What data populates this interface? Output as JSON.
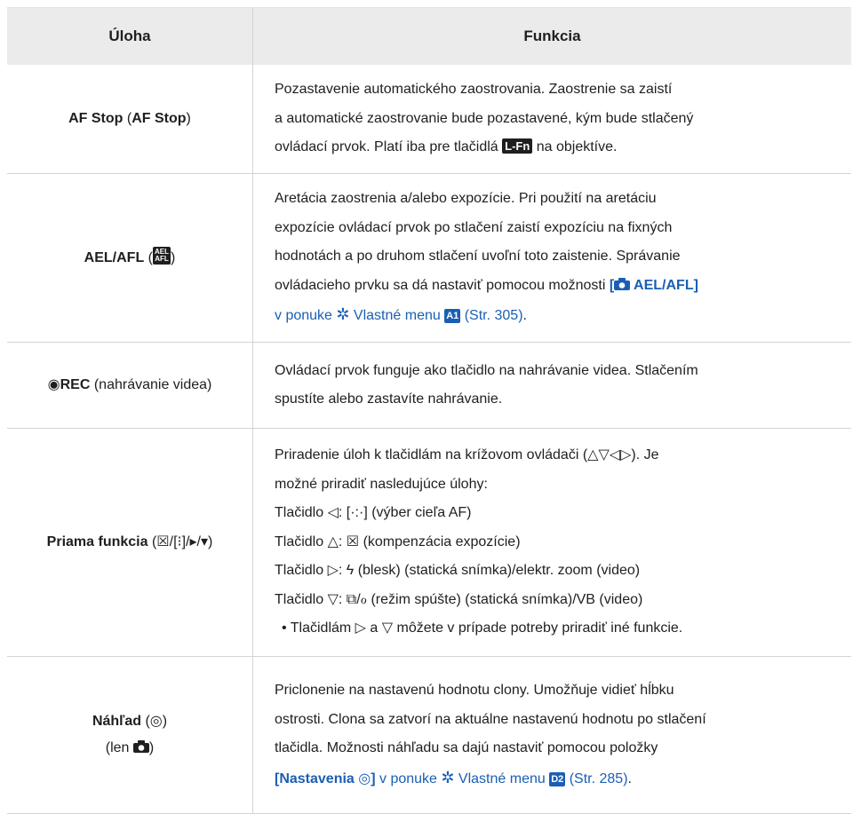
{
  "header": {
    "col1": "Úloha",
    "col2": "Funkcia"
  },
  "rows": [
    {
      "task_b1": "AF Stop",
      "task_paren_open": " (",
      "task_b2": "AF Stop",
      "task_paren_close": ")",
      "lines": [
        "Pozastavenie automatického zaostrovania. Zaostrenie sa zaistí",
        "a automatické zaostrovanie bude pozastavené, kým bude stlačený"
      ],
      "line3_pre": "ovládací prvok. Platí iba pre tlačidlá ",
      "icon_lfn": "L-Fn",
      "line3_post": " na objektíve."
    },
    {
      "task_b": "AEL/AFL",
      "task_paren_open": " (",
      "icon_aelafl_1": "AEL",
      "icon_aelafl_2": "AFL",
      "task_paren_close": ")",
      "lines": [
        "Aretácia zaostrenia a/alebo expozície. Pri použití na aretáciu",
        "expozície ovládací prvok po stlačení zaistí expozíciu na fixných",
        "hodnotách a po druhom stlačení uvoľní toto zaistenie. Správanie"
      ],
      "line4_pre": "ovládacieho prvku sa dá nastaviť pomocou možnosti ",
      "line4_link_open": "[",
      "line4_link_text": " AEL/AFL]",
      "line5_text": "v ponuke ",
      "line5_gear": "✲",
      "line5_menu": " Vlastné menu ",
      "line5_badge": "A1",
      "line5_ref": " (Str. 305)",
      "line5_end": "."
    },
    {
      "task_icon": "◉",
      "task_b": "REC",
      "task_rest": " (nahrávanie videa)",
      "lines": [
        "Ovládací prvok funguje ako tlačidlo na nahrávanie videa. Stlačením",
        "spustíte alebo zastavíte nahrávanie."
      ]
    },
    {
      "task_b": "Priama funkcia",
      "task_icons": " (☒/[⁝]/▸/▾)",
      "lines": [
        "Priradenie úloh k tlačidlám na krížovom ovládači (△▽◁▷). Je",
        "možné priradiť nasledujúce úlohy:",
        "Tlačidlo ◁: [·:·] (výber cieľa AF)",
        "Tlačidlo △: ☒ (kompenzácia expozície)",
        "Tlačidlo ▷: ϟ (blesk) (statická snímka)/elektr. zoom (video)",
        "Tlačidlo ▽: ⧉/ℴ (režim spúšte) (statická snímka)/VB (video)",
        "• Tlačidlám ▷ a ▽ môžete v prípade potreby priradiť iné funkcie."
      ]
    },
    {
      "task_b": "Náhľad",
      "task_rest": " (◎)",
      "task_line2_pre": "(len ",
      "task_line2_post": ")",
      "lines": [
        "Priclonenie na nastavenú hodnotu clony. Umožňuje vidieť hĺbku",
        "ostrosti. Clona sa zatvorí na aktuálne nastavenú hodnotu po stlačení",
        "tlačidla. Možnosti náhľadu sa dajú nastaviť pomocou položky"
      ],
      "line4_link": "[Nastavenia ◎]",
      "line4_text": " v ponuke ",
      "line4_gear": "✲",
      "line4_menu": " Vlastné menu ",
      "line4_badge": "D2",
      "line4_ref": " (Str. 285)",
      "line4_end": "."
    }
  ],
  "colors": {
    "link": "#1a5fb4",
    "header_bg": "#ebebeb",
    "border": "#d4d4d4"
  },
  "icons": [
    "l-fn-button-icon",
    "ael-afl-button-icon",
    "camera-icon",
    "gear-icon",
    "record-icon",
    "preview-icon"
  ]
}
